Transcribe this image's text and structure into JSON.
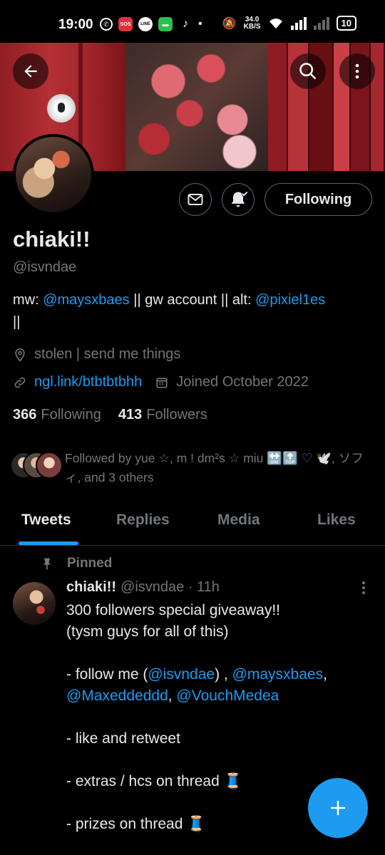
{
  "status_bar": {
    "time": "19:00",
    "net_speed_value": "34.0",
    "net_speed_unit": "KB/S",
    "battery": "10",
    "sos_label": "SOS",
    "line_label": "LINE"
  },
  "profile": {
    "name": "chiaki!!",
    "handle": "@isvndae",
    "following_button": "Following",
    "bio_prefix": "mw: ",
    "bio_link1": "@maysxbaes",
    "bio_middle": " || gw account  || alt: ",
    "bio_link2": "@pixiel1es",
    "bio_suffix": " ||",
    "location": "stolen | send me things",
    "website": "ngl.link/btbtbtbhh",
    "joined": "Joined October 2022",
    "following_count": "366",
    "following_label": "Following",
    "followers_count": "413",
    "followers_label": "Followers",
    "followed_by": "Followed by yue ☆, m ! dm²s ☆ miu 🔛🔝 ♡ 🕊️, ソフィ, and 3 others"
  },
  "tabs": [
    {
      "label": "Tweets",
      "active": true
    },
    {
      "label": "Replies",
      "active": false
    },
    {
      "label": "Media",
      "active": false
    },
    {
      "label": "Likes",
      "active": false
    }
  ],
  "tweet": {
    "pinned_label": "Pinned",
    "author_name": "chiaki!!",
    "author_handle": "@isvndae · 11h",
    "line1": "300 followers special giveaway!!",
    "line2": "(tysm guys for all of this)",
    "line3_prefix": "- follow me (",
    "line3_link1": "@isvndae",
    "line3_mid": ") , ",
    "line3_link2": "@maysxbaes",
    "line3_comma": ",",
    "line4_link1": "@Maxeddeddd",
    "line4_mid": ", ",
    "line4_link2": "@VouchMedea",
    "line5": "- like and retweet",
    "line6": "- extras / hcs on thread 🧵",
    "line7": "- prizes on thread 🧵"
  },
  "colors": {
    "accent": "#1d9bf0",
    "background": "#000000",
    "text_primary": "#e7e9ea",
    "text_secondary": "#71767b",
    "border": "#536471"
  },
  "icons": [
    "back-arrow-icon",
    "search-icon",
    "more-vertical-icon",
    "message-icon",
    "bell-check-icon",
    "location-pin-icon",
    "link-icon",
    "calendar-icon",
    "pin-icon",
    "compose-plus-icon"
  ]
}
